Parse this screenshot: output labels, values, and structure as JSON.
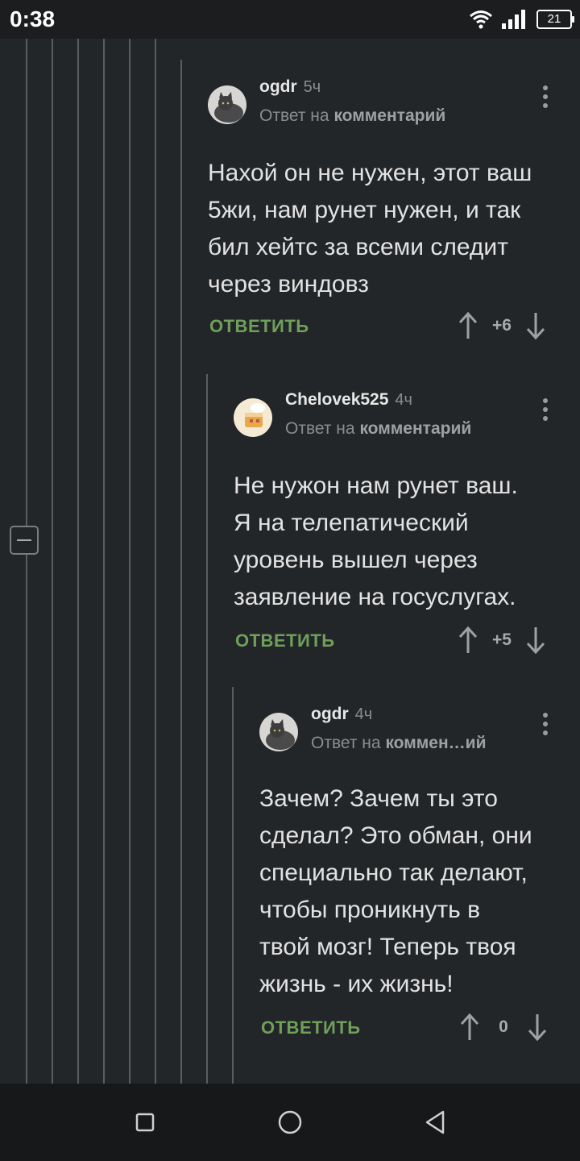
{
  "status_bar": {
    "time": "0:38",
    "battery": "21"
  },
  "comments": [
    {
      "author": "ogdr",
      "time": "5ч",
      "reply_prefix": "Ответ на",
      "reply_target": "комментарий",
      "body_lines": [
        "Нахой он не нужен, этот ваш",
        "5жи, нам рунет нужен, и так",
        "бил хейтс за всеми следит",
        "через виндовз"
      ],
      "reply_label": "ОТВЕТИТЬ",
      "score": "+6",
      "avatar_icon": "cat-avatar"
    },
    {
      "author": "Chelovek525",
      "time": "4ч",
      "reply_prefix": "Ответ на",
      "reply_target": "комментарий",
      "body_lines": [
        "Не нужон нам рунет ваш.",
        "Я на телепатический",
        "уровень вышел через",
        "заявление на госуслугах."
      ],
      "reply_label": "ОТВЕТИТЬ",
      "score": "+5",
      "avatar_icon": "cake-avatar"
    },
    {
      "author": "ogdr",
      "time": "4ч",
      "reply_prefix": "Ответ на",
      "reply_target": "коммен…ий",
      "body_lines": [
        "Зачем? Зачем ты это",
        "сделал? Это обман, они",
        "специально так делают,",
        "чтобы проникнуть в",
        "твой мозг! Теперь твоя",
        "жизнь - их жизнь!"
      ],
      "reply_label": "ОТВЕТИТЬ",
      "score": "0",
      "avatar_icon": "cat-avatar"
    }
  ],
  "icons": {
    "wifi": "wifi-icon",
    "signal": "signal-icon",
    "battery": "battery-icon",
    "collapse": "minus-icon",
    "more": "more-vertical-icon",
    "upvote": "arrow-up-icon",
    "downvote": "arrow-down-icon",
    "nav_recent": "square-icon",
    "nav_home": "circle-icon",
    "nav_back": "triangle-back-icon"
  }
}
